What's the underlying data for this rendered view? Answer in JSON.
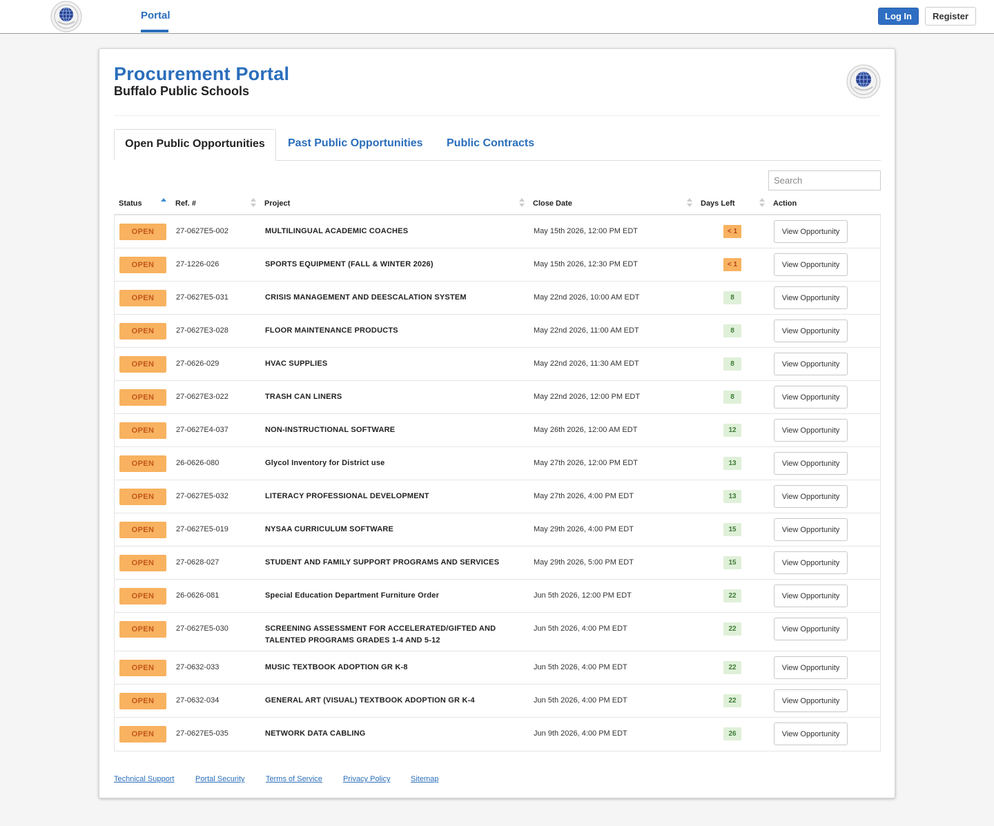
{
  "nav": {
    "portal_tab": "Portal",
    "login_label": "Log In",
    "register_label": "Register",
    "accent_color": "#2a6ebb"
  },
  "header": {
    "title": "Procurement Portal",
    "subtitle": "Buffalo Public Schools",
    "logo_icon": "district-seal-icon"
  },
  "tabs": [
    {
      "label": "Open Public Opportunities",
      "active": true
    },
    {
      "label": "Past Public Opportunities",
      "active": false
    },
    {
      "label": "Public Contracts",
      "active": false
    }
  ],
  "search": {
    "placeholder": "Search"
  },
  "table": {
    "columns": [
      "Status",
      "Ref. #",
      "Project",
      "Close Date",
      "Days Left",
      "Action"
    ],
    "sorted_column": "Status",
    "sort_direction": "ascending",
    "rows": [
      {
        "status": "OPEN",
        "ref": "27-0627E5-002",
        "project": "MULTILINGUAL ACADEMIC COACHES",
        "close": "May 15th 2026, 12:00 PM EDT",
        "days": "< 1",
        "urgent": true,
        "action": "View Opportunity"
      },
      {
        "status": "OPEN",
        "ref": "27-1226-026",
        "project": "SPORTS EQUIPMENT (FALL & WINTER 2026)",
        "close": "May 15th 2026, 12:30 PM EDT",
        "days": "< 1",
        "urgent": true,
        "action": "View Opportunity"
      },
      {
        "status": "OPEN",
        "ref": "27-0627E5-031",
        "project": "CRISIS MANAGEMENT AND DEESCALATION SYSTEM",
        "close": "May 22nd 2026, 10:00 AM EDT",
        "days": "8",
        "urgent": false,
        "action": "View Opportunity"
      },
      {
        "status": "OPEN",
        "ref": "27-0627E3-028",
        "project": "FLOOR MAINTENANCE PRODUCTS",
        "close": "May 22nd 2026, 11:00 AM EDT",
        "days": "8",
        "urgent": false,
        "action": "View Opportunity"
      },
      {
        "status": "OPEN",
        "ref": "27-0626-029",
        "project": "HVAC SUPPLIES",
        "close": "May 22nd 2026, 11:30 AM EDT",
        "days": "8",
        "urgent": false,
        "action": "View Opportunity"
      },
      {
        "status": "OPEN",
        "ref": "27-0627E3-022",
        "project": "TRASH CAN LINERS",
        "close": "May 22nd 2026, 12:00 PM EDT",
        "days": "8",
        "urgent": false,
        "action": "View Opportunity"
      },
      {
        "status": "OPEN",
        "ref": "27-0627E4-037",
        "project": "NON-INSTRUCTIONAL SOFTWARE",
        "close": "May 26th 2026, 12:00 AM EDT",
        "days": "12",
        "urgent": false,
        "action": "View Opportunity"
      },
      {
        "status": "OPEN",
        "ref": "26-0626-080",
        "project": "Glycol Inventory for District use",
        "close": "May 27th 2026, 12:00 PM EDT",
        "days": "13",
        "urgent": false,
        "action": "View Opportunity"
      },
      {
        "status": "OPEN",
        "ref": "27-0627E5-032",
        "project": "LITERACY PROFESSIONAL DEVELOPMENT",
        "close": "May 27th 2026, 4:00 PM EDT",
        "days": "13",
        "urgent": false,
        "action": "View Opportunity"
      },
      {
        "status": "OPEN",
        "ref": "27-0627E5-019",
        "project": "NYSAA CURRICULUM SOFTWARE",
        "close": "May 29th 2026, 4:00 PM EDT",
        "days": "15",
        "urgent": false,
        "action": "View Opportunity"
      },
      {
        "status": "OPEN",
        "ref": "27-0628-027",
        "project": "STUDENT AND FAMILY SUPPORT PROGRAMS AND SERVICES",
        "close": "May 29th 2026, 5:00 PM EDT",
        "days": "15",
        "urgent": false,
        "action": "View Opportunity"
      },
      {
        "status": "OPEN",
        "ref": "26-0626-081",
        "project": "Special Education Department Furniture Order",
        "close": "Jun 5th 2026, 12:00 PM EDT",
        "days": "22",
        "urgent": false,
        "action": "View Opportunity"
      },
      {
        "status": "OPEN",
        "ref": "27-0627E5-030",
        "project": "SCREENING ASSESSMENT FOR ACCELERATED/GIFTED AND TALENTED PROGRAMS GRADES 1-4 AND 5-12",
        "close": "Jun 5th 2026, 4:00 PM EDT",
        "days": "22",
        "urgent": false,
        "action": "View Opportunity"
      },
      {
        "status": "OPEN",
        "ref": "27-0632-033",
        "project": "MUSIC TEXTBOOK ADOPTION GR K-8",
        "close": "Jun 5th 2026, 4:00 PM EDT",
        "days": "22",
        "urgent": false,
        "action": "View Opportunity"
      },
      {
        "status": "OPEN",
        "ref": "27-0632-034",
        "project": "GENERAL ART (VISUAL) TEXTBOOK ADOPTION GR K-4",
        "close": "Jun 5th 2026, 4:00 PM EDT",
        "days": "22",
        "urgent": false,
        "action": "View Opportunity"
      },
      {
        "status": "OPEN",
        "ref": "27-0627E5-035",
        "project": "NETWORK DATA CABLING",
        "close": "Jun 9th 2026, 4:00 PM EDT",
        "days": "26",
        "urgent": false,
        "action": "View Opportunity"
      }
    ]
  },
  "footer": {
    "links": [
      "Technical Support",
      "Portal Security",
      "Terms of Service",
      "Privacy Policy",
      "Sitemap"
    ]
  }
}
